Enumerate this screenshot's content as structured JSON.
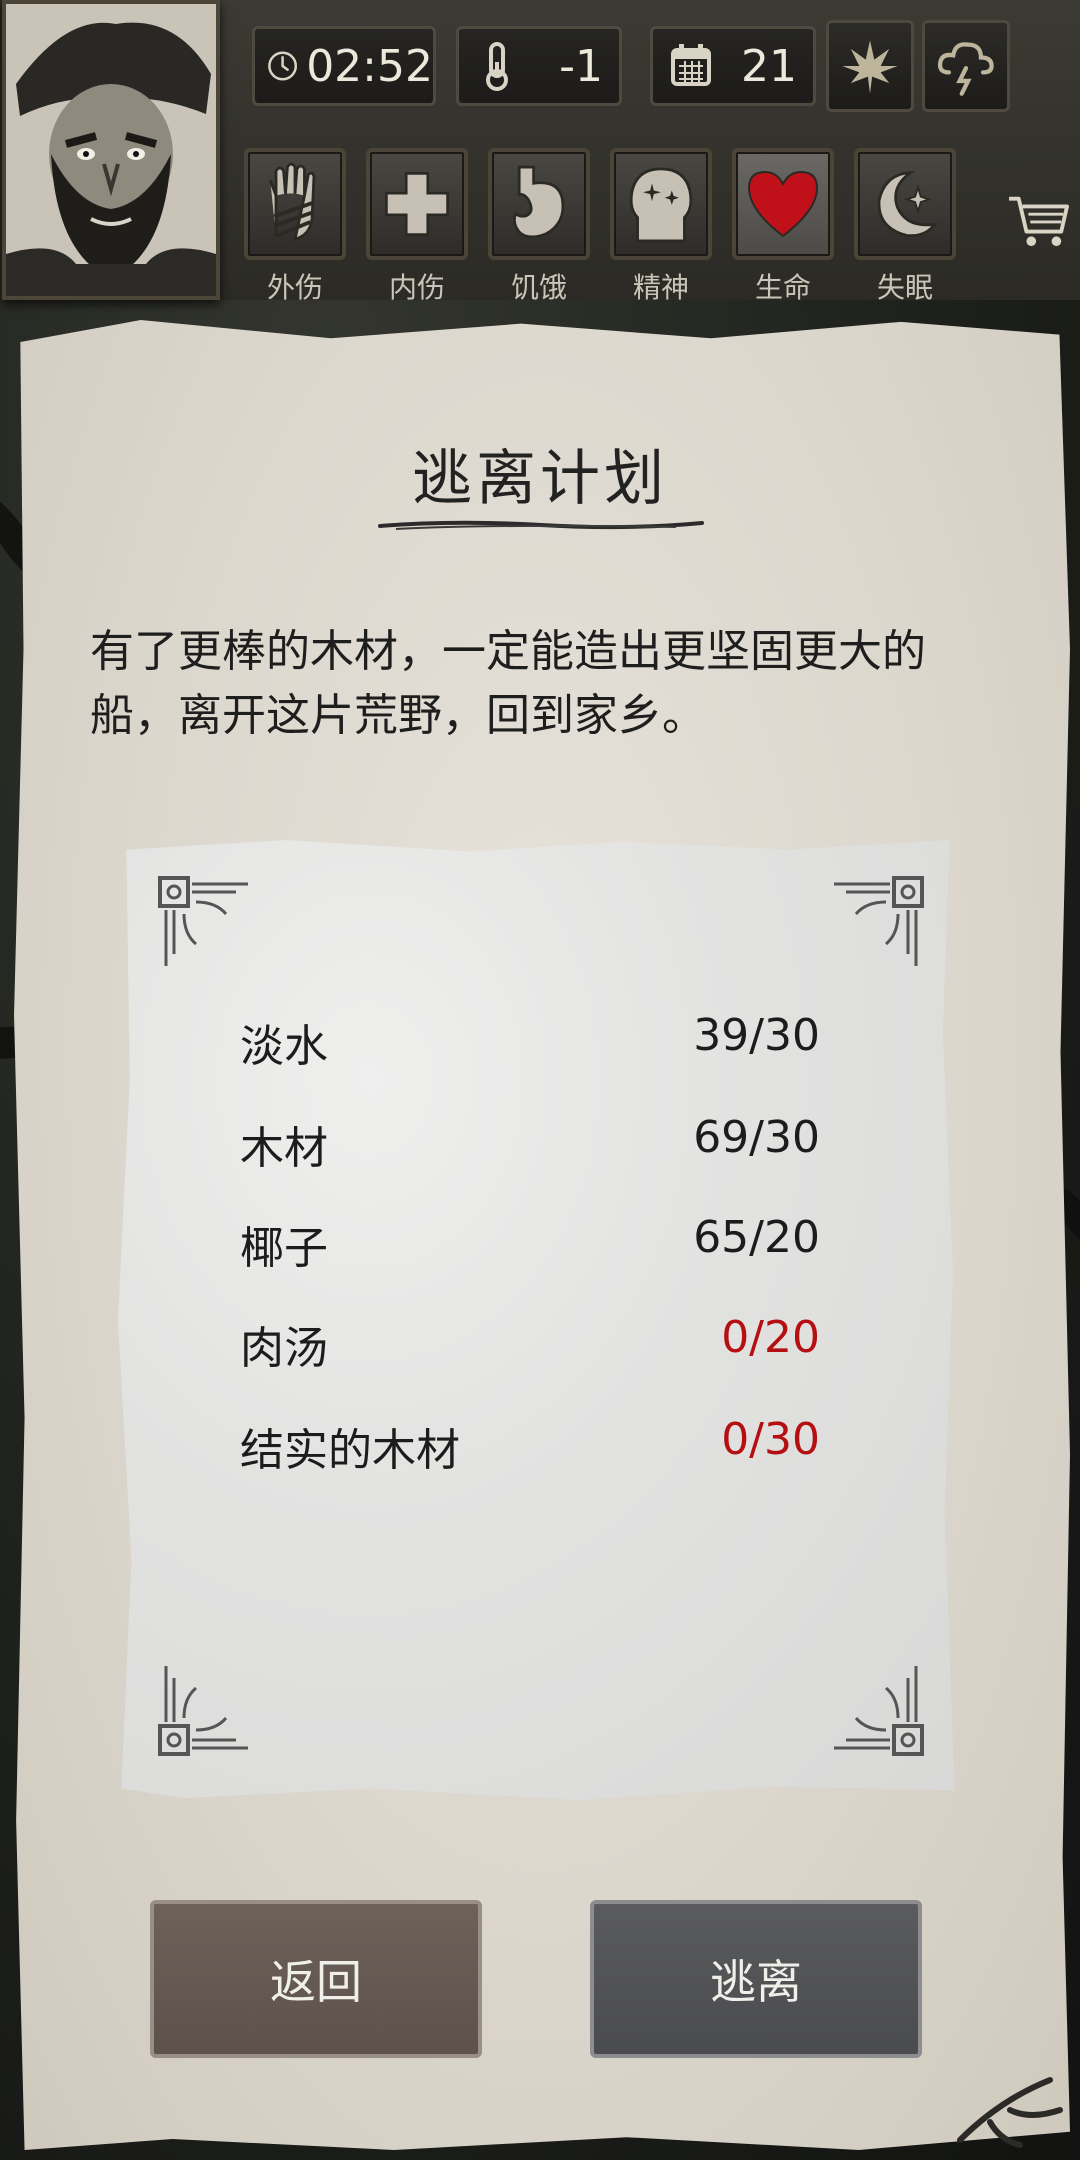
{
  "hud": {
    "clock": "02:52",
    "temperature": "-1",
    "day": "21",
    "season_icon": "leaf-icon",
    "weather_icon": "storm-cloud-icon"
  },
  "status_bar": [
    {
      "label": "外伤",
      "icon": "bandaged-hand-icon"
    },
    {
      "label": "内伤",
      "icon": "cross-icon"
    },
    {
      "label": "饥饿",
      "icon": "stomach-icon"
    },
    {
      "label": "精神",
      "icon": "head-sparkle-icon"
    },
    {
      "label": "生命",
      "icon": "heart-icon"
    },
    {
      "label": "失眠",
      "icon": "moon-star-icon"
    }
  ],
  "plan": {
    "title": "逃离计划",
    "description": "有了更棒的木材，一定能造出更坚固更大的船，离开这片荒野，回到家乡。"
  },
  "requirements": [
    {
      "name": "淡水",
      "count": "39/30",
      "met": true
    },
    {
      "name": "木材",
      "count": "69/30",
      "met": true
    },
    {
      "name": "椰子",
      "count": "65/20",
      "met": true
    },
    {
      "name": "肉汤",
      "count": "0/20",
      "met": false
    },
    {
      "name": "结实的木材",
      "count": "0/30",
      "met": false
    }
  ],
  "buttons": {
    "back": "返回",
    "escape": "逃离"
  },
  "colors": {
    "short_count": "#b50f12",
    "heart": "#c0101a"
  }
}
